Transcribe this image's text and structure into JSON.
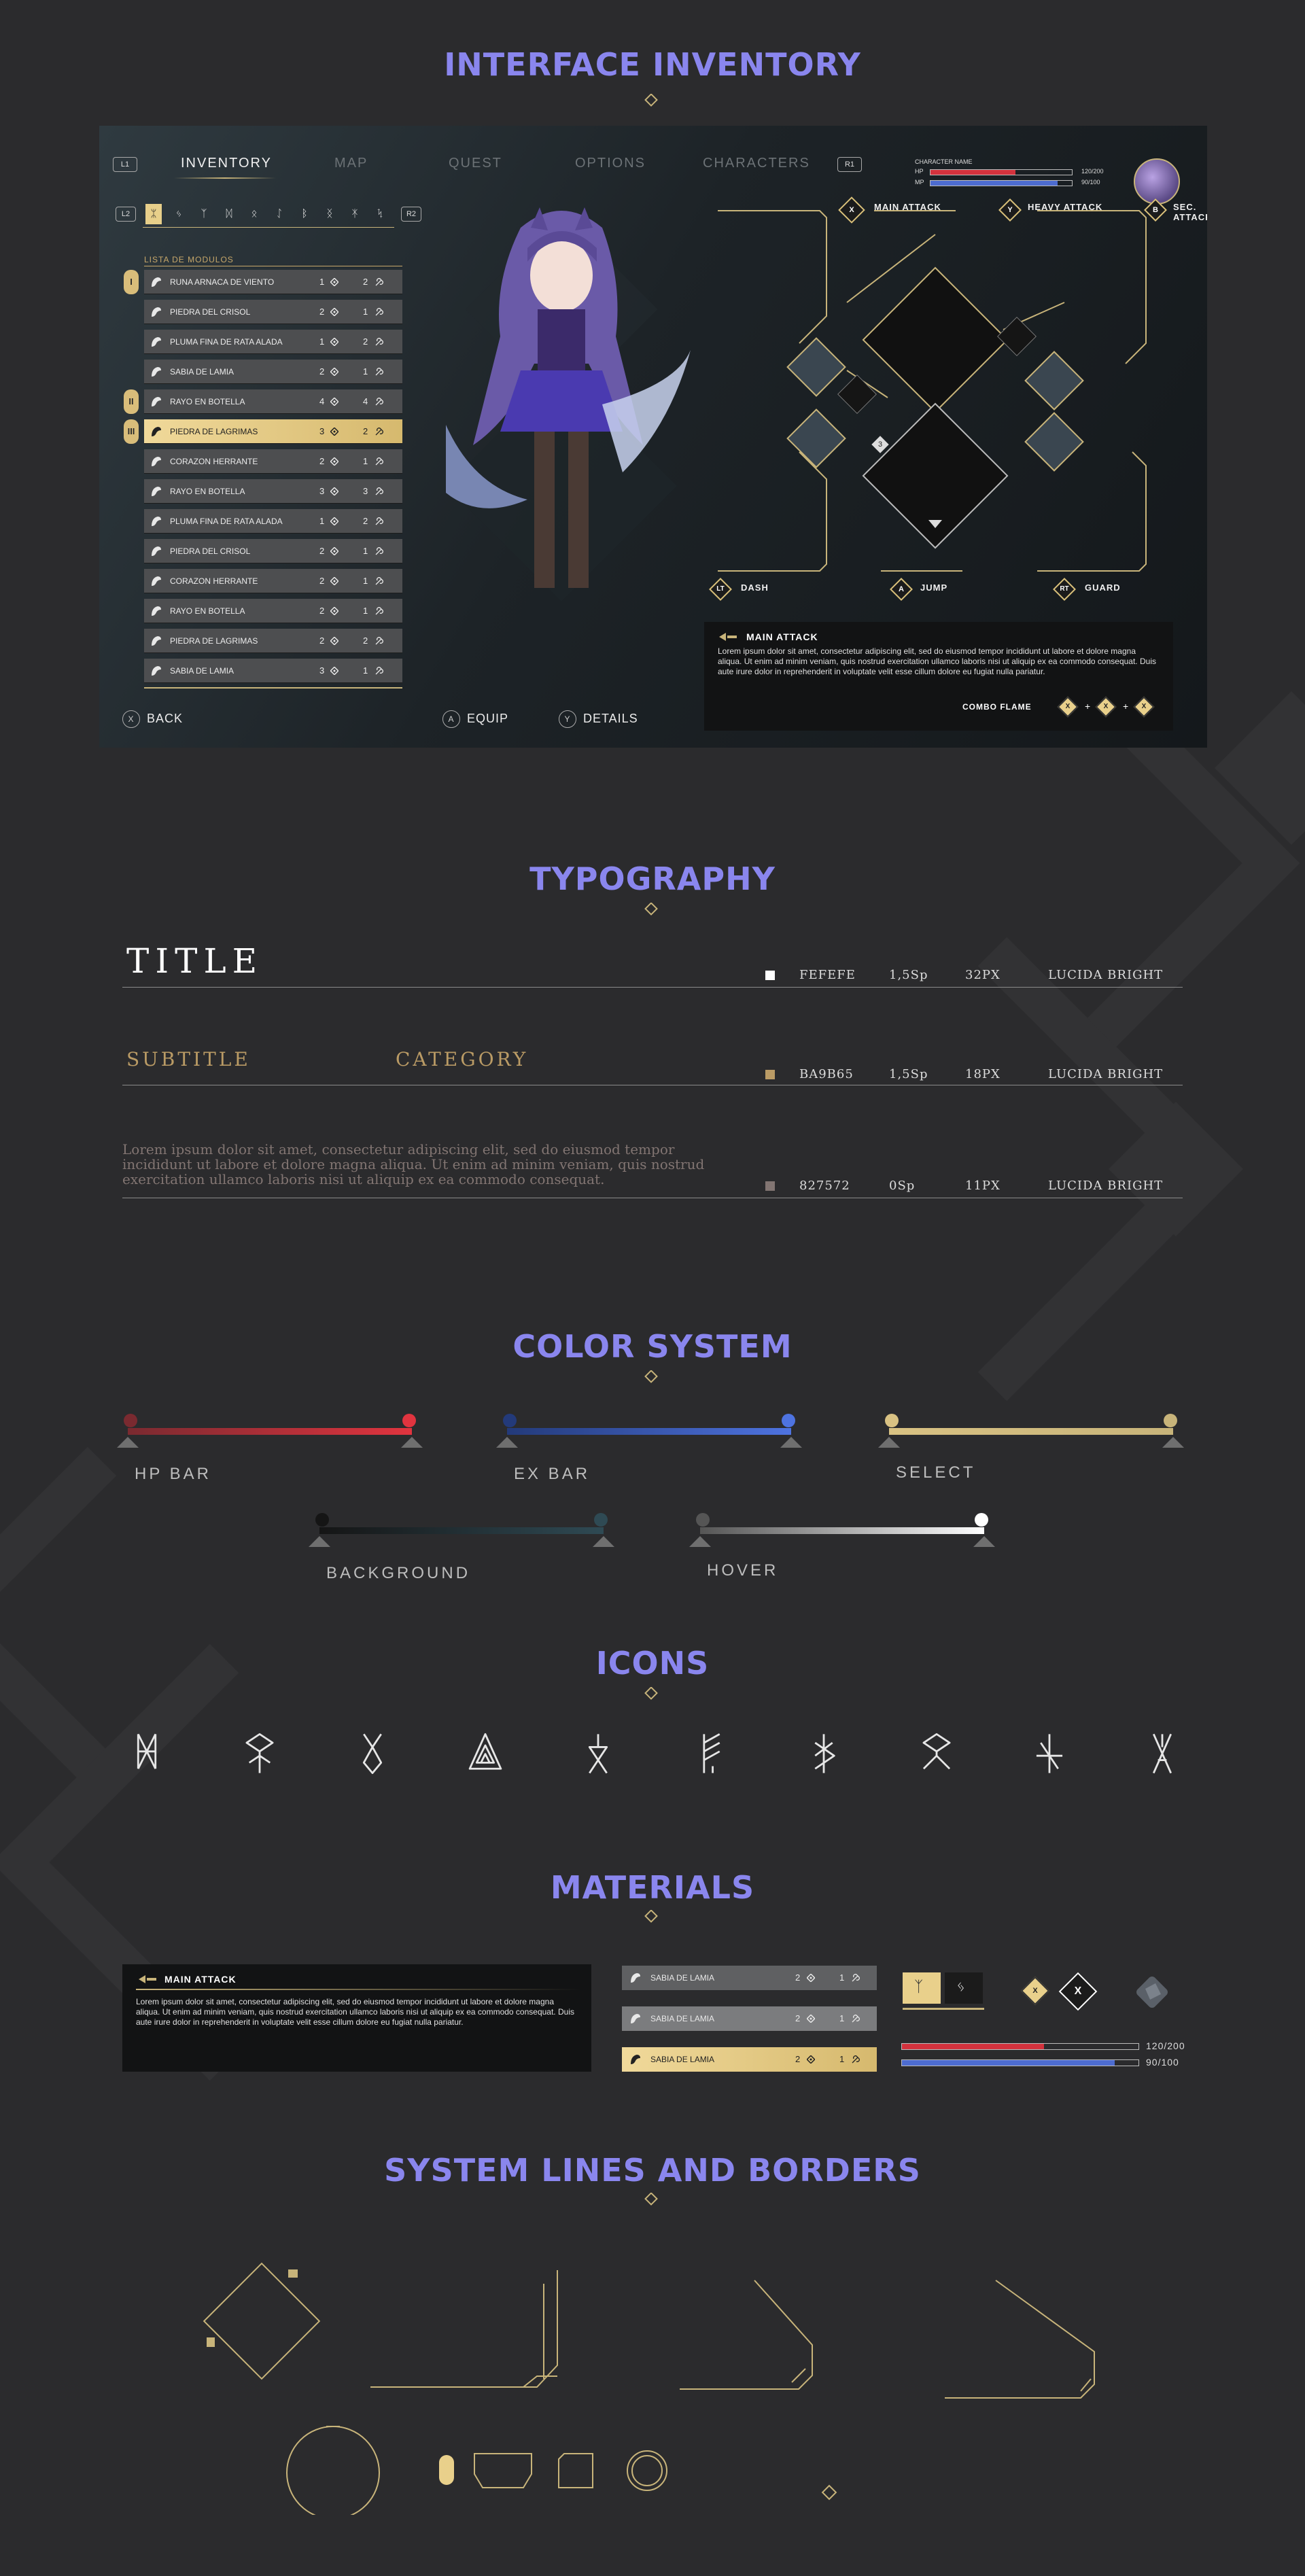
{
  "sections": {
    "inventory": "INTERFACE INVENTORY",
    "typography": "TYPOGRAPHY",
    "color_system": "COLOR SYSTEM",
    "icons": "ICONS",
    "materials": "MATERIALS",
    "lines": "SYSTEM LINES AND BORDERS"
  },
  "nav": {
    "left_bumper": "L1",
    "right_bumper": "R1",
    "tabs": [
      "INVENTORY",
      "MAP",
      "QUEST",
      "OPTIONS",
      "CHARACTERS"
    ]
  },
  "character": {
    "name_label": "CHARACTER NAME",
    "hp_label": "HP",
    "mp_label": "MP",
    "hp_value": "120/200",
    "mp_value": "90/100",
    "hp_fraction": 0.6,
    "mp_fraction": 0.9
  },
  "filter": {
    "left": "L2",
    "right": "R2",
    "runes": [
      "ᛯ",
      "ᛃ",
      "ᛉ",
      "ᛞ",
      "ᛟ",
      "ᛇ",
      "ᛒ",
      "ᛝ",
      "ᛡ",
      "ᛪ"
    ]
  },
  "list": {
    "header": "LISTA DE MODULOS",
    "items": [
      {
        "label": "RUNA ARNACA DE VIENTO",
        "a": "1",
        "b": "2"
      },
      {
        "label": "PIEDRA DEL CRISOL",
        "a": "2",
        "b": "1"
      },
      {
        "label": "PLUMA FINA DE RATA ALADA",
        "a": "1",
        "b": "2"
      },
      {
        "label": "SABIA DE LAMIA",
        "a": "2",
        "b": "1"
      },
      {
        "label": "RAYO EN BOTELLA",
        "a": "4",
        "b": "4"
      },
      {
        "label": "PIEDRA DE LAGRIMAS",
        "a": "3",
        "b": "2"
      },
      {
        "label": "CORAZON HERRANTE",
        "a": "2",
        "b": "1"
      },
      {
        "label": "RAYO EN BOTELLA",
        "a": "3",
        "b": "3"
      },
      {
        "label": "PLUMA FINA DE RATA ALADA",
        "a": "1",
        "b": "2"
      },
      {
        "label": "PIEDRA DEL CRISOL",
        "a": "2",
        "b": "1"
      },
      {
        "label": "CORAZON HERRANTE",
        "a": "2",
        "b": "1"
      },
      {
        "label": "RAYO EN BOTELLA",
        "a": "2",
        "b": "1"
      },
      {
        "label": "PIEDRA DE LAGRIMAS",
        "a": "2",
        "b": "2"
      },
      {
        "label": "SABIA DE LAMIA",
        "a": "3",
        "b": "1"
      }
    ],
    "tiers": [
      "I",
      "II",
      "III"
    ]
  },
  "actions": {
    "back_key": "X",
    "back": "BACK",
    "equip_key": "A",
    "equip": "EQUIP",
    "details_key": "Y",
    "details": "DETAILS"
  },
  "skills": {
    "main_key": "X",
    "main": "MAIN ATTACK",
    "heavy_key": "Y",
    "heavy": "HEAVY ATTACK",
    "sec_key": "B",
    "sec": "SEC. ATTACK",
    "dash_key": "LT",
    "dash": "DASH",
    "jump_key": "A",
    "jump": "JUMP",
    "guard_key": "RT",
    "guard": "GUARD",
    "lock_count": "3"
  },
  "description": {
    "title": "MAIN ATTACK",
    "body": "Lorem ipsum dolor sit amet, consectetur adipiscing elit, sed do eiusmod tempor incididunt ut labore et dolore magna aliqua. Ut enim ad minim veniam, quis nostrud exercitation ullamco laboris nisi ut aliquip ex ea commodo consequat. Duis aute irure dolor in reprehenderit in voluptate velit esse cillum dolore eu fugiat nulla pariatur.",
    "combo_label": "COMBO FLAME",
    "combo": [
      "X",
      "+",
      "X",
      "+",
      "X"
    ]
  },
  "typography": {
    "title": "TITLE",
    "subtitle": "SUBTITLE",
    "category": "CATEGORY",
    "body": "Lorem ipsum dolor sit amet, consectetur adipiscing elit, sed do eiusmod tempor incididunt ut labore et dolore magna aliqua. Ut enim ad minim veniam, quis nostrud exercitation ullamco laboris nisi ut aliquip ex ea commodo consequat.",
    "specs": [
      {
        "color": "#FEFEFE",
        "hex": "FEFEFE",
        "spacing": "1,5Sp",
        "size": "32PX",
        "font": "LUCIDA BRIGHT"
      },
      {
        "color": "#BA9B65",
        "hex": "BA9B65",
        "spacing": "1,5Sp",
        "size": "18PX",
        "font": "LUCIDA BRIGHT"
      },
      {
        "color": "#827572",
        "hex": "827572",
        "spacing": "0Sp",
        "size": "11PX",
        "font": "LUCIDA BRIGHT"
      }
    ]
  },
  "colors": {
    "hp_bar": {
      "label": "HP BAR",
      "from": "#7a2a30",
      "to": "#e1343f"
    },
    "ex_bar": {
      "label": "EX BAR",
      "from": "#233a7a",
      "to": "#4e73e0"
    },
    "select": {
      "label": "SELECT",
      "from": "#d9c283",
      "to": "#c8b47a"
    },
    "background": {
      "label": "BACKGROUND",
      "from": "#151515",
      "to": "#2f4a54"
    },
    "hover": {
      "label": "HOVER",
      "from": "#555555",
      "to": "#ffffff"
    }
  },
  "icons": [
    "rune-1-icon",
    "rune-2-icon",
    "rune-3-icon",
    "rune-4-icon",
    "rune-5-icon",
    "rune-6-icon",
    "rune-7-icon",
    "rune-8-icon",
    "rune-9-icon",
    "rune-10-icon"
  ],
  "materials": {
    "desc_title": "MAIN ATTACK",
    "desc_body": "Lorem ipsum dolor sit amet, consectetur adipiscing elit, sed do eiusmod tempor incididunt ut labore et dolore magna aliqua. Ut enim ad minim veniam, quis nostrud exercitation ullamco laboris nisi ut aliquip ex ea commodo consequat. Duis aute irure dolor in reprehenderit in voluptate velit esse cillum dolore eu fugiat nulla pariatur.",
    "item_label": "SABIA DE LAMIA",
    "item_a": "2",
    "item_b": "1",
    "key_x": "X",
    "hp_value": "120/200",
    "mp_value": "90/100"
  },
  "accent": "#c8b47a"
}
